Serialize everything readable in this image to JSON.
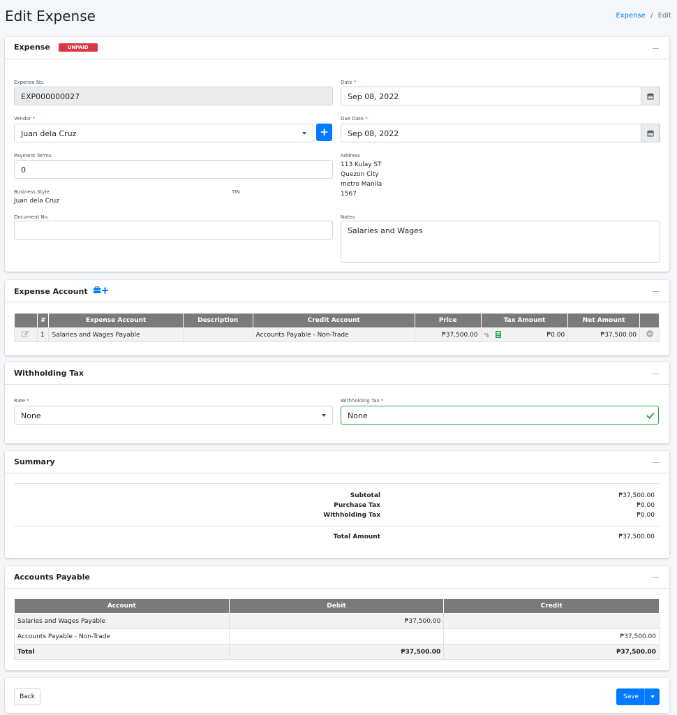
{
  "header": {
    "title": "Edit Expense",
    "breadcrumb": {
      "link": "Expense",
      "separator": "/",
      "current": "Edit"
    }
  },
  "expense_card": {
    "title": "Expense",
    "status_badge": "UNPAID",
    "fields": {
      "expense_no_label": "Expense No.",
      "expense_no_value": "EXP000000027",
      "date_label": "Date",
      "date_value": "Sep 08, 2022",
      "vendor_label": "Vendor",
      "vendor_value": "Juan dela Cruz",
      "due_date_label": "Due Date",
      "due_date_value": "Sep 08, 2022",
      "payment_terms_label": "Payment Terms",
      "payment_terms_value": "0",
      "address_label": "Address",
      "address_lines": [
        "113 Kulay ST",
        "Quezon City",
        "metro Manila",
        "1567"
      ],
      "business_style_label": "Business Style",
      "business_style_value": "Juan dela Cruz",
      "tin_label": "TIN",
      "document_no_label": "Document No.",
      "document_no_value": "",
      "notes_label": "Notes",
      "notes_value": "Salaries and Wages",
      "required_mark": "*",
      "add_vendor_label": "+"
    }
  },
  "expense_account_card": {
    "title": "Expense Account",
    "columns": [
      "",
      "#",
      "Expense Account",
      "Description",
      "Credit Account",
      "Price",
      "Tax Amount",
      "Net Amount",
      ""
    ],
    "rows": [
      {
        "num": "1",
        "expense_account": "Salaries and Wages Payable",
        "description": "",
        "credit_account": "Accounts Payable - Non-Trade",
        "price": "₱37,500.00",
        "tax_amount": "₱0.00",
        "net_amount": "₱37,500.00"
      }
    ]
  },
  "withholding_card": {
    "title": "Withholding Tax",
    "rate_label": "Rate",
    "rate_value": "None",
    "tax_label": "Withholding Tax",
    "tax_value": "None"
  },
  "summary_card": {
    "title": "Summary",
    "rows": [
      {
        "label": "Subtotal",
        "value": "₱37,500.00"
      },
      {
        "label": "Purchase Tax",
        "value": "₱0.00"
      },
      {
        "label": "Withholding Tax",
        "value": "₱0.00"
      }
    ],
    "total_label": "Total Amount",
    "total_value": "₱37,500.00"
  },
  "ap_card": {
    "title": "Accounts Payable",
    "columns": [
      "Account",
      "Debit",
      "Credit"
    ],
    "rows": [
      {
        "account": "Salaries and Wages Payable",
        "debit": "₱37,500.00",
        "credit": ""
      },
      {
        "account": "Accounts Payable - Non-Trade",
        "debit": "",
        "credit": "₱37,500.00"
      }
    ],
    "total": {
      "account": "Total",
      "debit": "₱37,500.00",
      "credit": "₱37,500.00"
    }
  },
  "footer": {
    "back_label": "Back",
    "save_label": "Save"
  },
  "colors": {
    "primary": "#007bff",
    "danger": "#dc3545",
    "success": "#28a745",
    "table_header": "#7a7a7a"
  }
}
